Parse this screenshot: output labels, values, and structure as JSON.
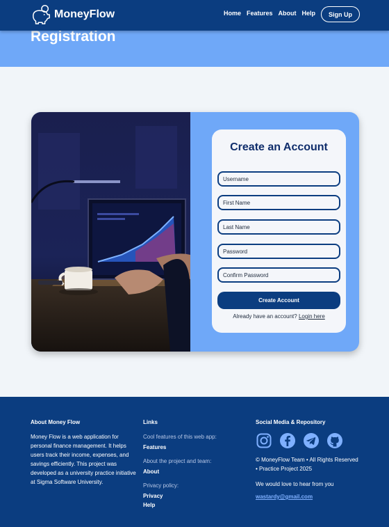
{
  "brand": {
    "name": "MoneyFlow"
  },
  "nav": {
    "items": [
      "Home",
      "Features",
      "About",
      "Help"
    ],
    "signup_label": "Sign Up"
  },
  "hero": {
    "title": "Registration"
  },
  "form": {
    "title": "Create an Account",
    "fields": {
      "username": "Username",
      "first_name": "First Name",
      "last_name": "Last Name",
      "password": "Password",
      "confirm_password": "Confirm Password"
    },
    "submit_label": "Create Account",
    "login_prompt": "Already have an account?",
    "login_link": "Login here"
  },
  "footer": {
    "about": {
      "heading": "About Money Flow",
      "text": "Money Flow is a web application for personal finance management. It helps users track their income, expenses, and savings efficiently. This project was developed as a university practice initiative at Sigma Software University."
    },
    "links": {
      "heading": "Links",
      "groups": [
        {
          "caption": "Cool features of this web app:",
          "links": [
            "Features"
          ]
        },
        {
          "caption": "About the project and team:",
          "links": [
            "About"
          ]
        },
        {
          "caption": "Privacy policy:",
          "links": [
            "Privacy",
            "Help"
          ]
        }
      ]
    },
    "social": {
      "heading": "Social Media & Repository",
      "icons": [
        "instagram-icon",
        "facebook-icon",
        "telegram-icon",
        "github-icon"
      ],
      "copyright": "© MoneyFlow Team • All Rights Reserved • Practice Project 2025",
      "contact_text": "We would love to hear from you",
      "email": "wastardy@gmail.com"
    }
  },
  "colors": {
    "primary": "#0b3d80",
    "accent": "#6fa8f8",
    "page_bg": "#f1f5f9"
  }
}
